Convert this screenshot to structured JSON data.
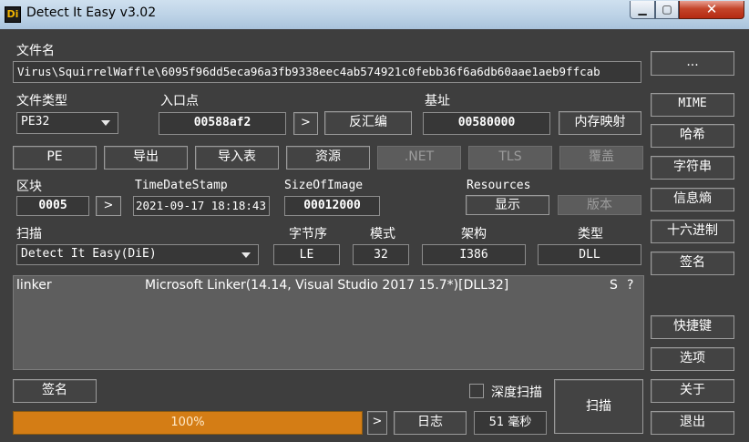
{
  "window": {
    "title": "Detect It Easy v3.02",
    "icon_text": "Di",
    "controls": {
      "minimize": "▁",
      "maximize": "▢",
      "close": "✕"
    }
  },
  "file": {
    "label": "文件名",
    "path": "Virus\\SquirrelWaffle\\6095f96dd5eca96a3fb9338eec4ab574921c0febb36f6a6db60aae1aeb9ffcab",
    "browse_label": "..."
  },
  "file_type": {
    "label": "文件类型",
    "value": "PE32"
  },
  "entry_point": {
    "label": "入口点",
    "value": "00588af2",
    "go_label": ">",
    "disasm_label": "反汇编"
  },
  "base_address": {
    "label": "基址",
    "value": "00580000",
    "memmap_label": "内存映射"
  },
  "tabs": [
    {
      "label": "PE",
      "enabled": true
    },
    {
      "label": "导出",
      "enabled": true
    },
    {
      "label": "导入表",
      "enabled": true
    },
    {
      "label": "资源",
      "enabled": true
    },
    {
      "label": ".NET",
      "enabled": false
    },
    {
      "label": "TLS",
      "enabled": false
    },
    {
      "label": "覆盖",
      "enabled": false
    }
  ],
  "sections": {
    "label": "区块",
    "value": "0005",
    "go_label": ">"
  },
  "timestamp": {
    "label": "TimeDateStamp",
    "value": "2021-09-17 18:18:43"
  },
  "size_of_image": {
    "label": "SizeOfImage",
    "value": "00012000"
  },
  "resources": {
    "label": "Resources",
    "show_label": "显示",
    "version_label": "版本"
  },
  "scan": {
    "label": "扫描",
    "engine": "Detect It Easy(DiE)",
    "endianness_label": "字节序",
    "endianness": "LE",
    "mode_label": "模式",
    "mode": "32",
    "arch_label": "架构",
    "arch": "I386",
    "type_label": "类型",
    "type": "DLL"
  },
  "results": [
    {
      "kind": "linker",
      "name": "Microsoft Linker(14.14, Visual Studio 2017 15.7*)[DLL32]",
      "s": "S",
      "q": "?"
    }
  ],
  "bottom": {
    "signature_label": "签名",
    "deep_scan_label": "深度扫描",
    "scan_button": "扫描",
    "progress_text": "100%",
    "progress_value": 1.0,
    "progress_arrow": ">",
    "log_label": "日志",
    "elapsed": "51 毫秒"
  },
  "sidebar": {
    "browse": "...",
    "mime": "MIME",
    "hash": "哈希",
    "strings": "字符串",
    "entropy": "信息熵",
    "hex": "十六进制",
    "signature": "签名",
    "shortcuts": "快捷键",
    "options": "选项",
    "about": "关于",
    "exit": "退出"
  },
  "colors": {
    "background": "#3e3e3e",
    "progress": "#d47d15",
    "results_bg": "#5e5e5e"
  }
}
